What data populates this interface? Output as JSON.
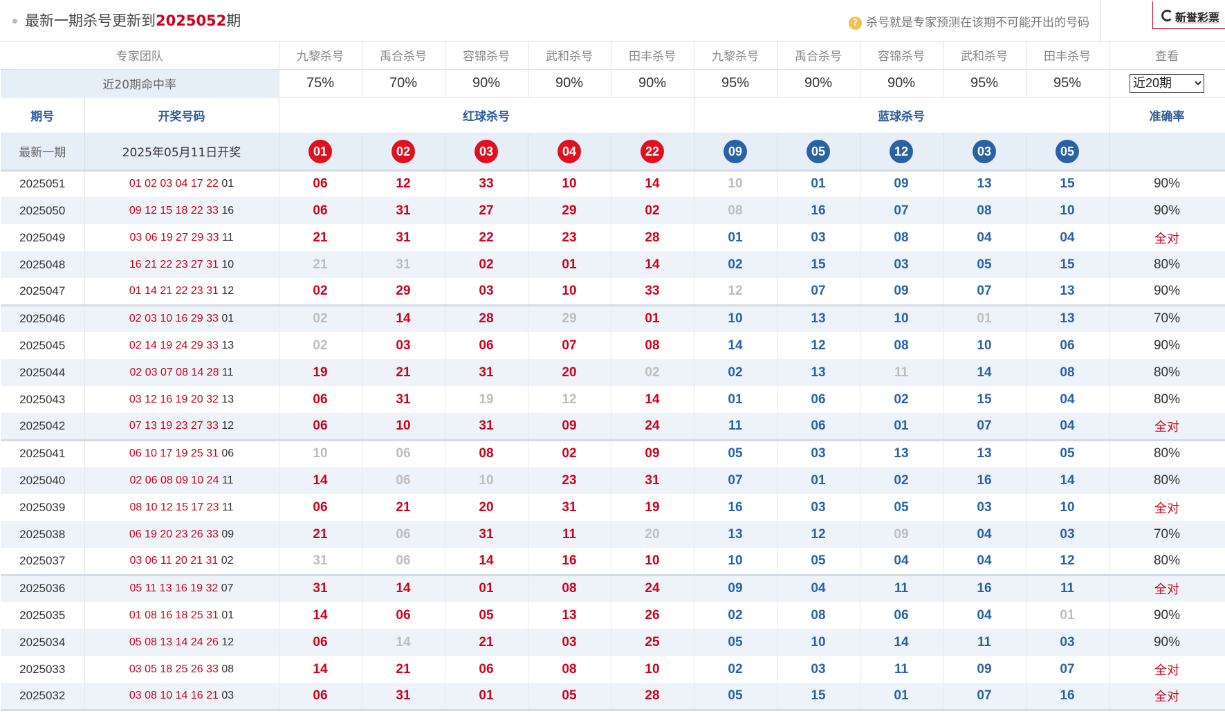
{
  "header": {
    "title_prefix": "最新一期杀号更新到",
    "issue": "2025052",
    "title_suffix": "期",
    "note_icon": "question-icon",
    "note": "杀号就是专家预测在该期不可能开出的号码",
    "logo_text": "新誉彩票"
  },
  "columns": {
    "team_label": "专家团队",
    "experts": [
      "九黎杀号",
      "禹合杀号",
      "容锦杀号",
      "武和杀号",
      "田丰杀号",
      "九黎杀号",
      "禹合杀号",
      "容锦杀号",
      "武和杀号",
      "田丰杀号"
    ],
    "view_label": "查看"
  },
  "hit_rates": {
    "label": "近20期命中率",
    "values": [
      "75%",
      "70%",
      "90%",
      "90%",
      "90%",
      "95%",
      "90%",
      "90%",
      "95%",
      "95%"
    ],
    "period_select": "近20期",
    "period_options": [
      "近20期"
    ]
  },
  "sections": {
    "issue_label": "期号",
    "draw_label": "开奖号码",
    "red_label": "红球杀号",
    "blue_label": "蓝球杀号",
    "accuracy_label": "准确率"
  },
  "latest": {
    "label": "最新一期",
    "draw_date": "2025年05月11日开奖",
    "red_kills": [
      "01",
      "02",
      "03",
      "04",
      "22"
    ],
    "blue_kills": [
      "09",
      "05",
      "12",
      "03",
      "05"
    ],
    "colors": {
      "red": "#e0101f",
      "blue": "#2a62a6"
    }
  },
  "history": [
    {
      "issue": "2025051",
      "red": "01 02 03 04 17 22",
      "blue": "01",
      "kills": [
        "06",
        "12",
        "33",
        "10",
        "14",
        "10",
        "01",
        "09",
        "13",
        "15"
      ],
      "miss": [
        5
      ],
      "acc": "90%"
    },
    {
      "issue": "2025050",
      "red": "09 12 15 18 22 33",
      "blue": "16",
      "kills": [
        "06",
        "31",
        "27",
        "29",
        "02",
        "08",
        "16",
        "07",
        "08",
        "10"
      ],
      "miss": [
        5
      ],
      "acc": "90%"
    },
    {
      "issue": "2025049",
      "red": "03 06 19 27 29 33",
      "blue": "11",
      "kills": [
        "21",
        "31",
        "22",
        "23",
        "28",
        "01",
        "03",
        "08",
        "04",
        "04"
      ],
      "miss": [],
      "acc": "全对"
    },
    {
      "issue": "2025048",
      "red": "16 21 22 23 27 31",
      "blue": "10",
      "kills": [
        "21",
        "31",
        "02",
        "01",
        "14",
        "02",
        "15",
        "03",
        "05",
        "15"
      ],
      "miss": [
        0,
        1
      ],
      "acc": "80%"
    },
    {
      "issue": "2025047",
      "red": "01 14 21 22 23 31",
      "blue": "12",
      "kills": [
        "02",
        "29",
        "03",
        "10",
        "33",
        "12",
        "07",
        "09",
        "07",
        "13"
      ],
      "miss": [
        5
      ],
      "acc": "90%"
    },
    {
      "issue": "2025046",
      "red": "02 03 10 16 29 33",
      "blue": "01",
      "kills": [
        "02",
        "14",
        "28",
        "29",
        "01",
        "10",
        "13",
        "10",
        "01",
        "13"
      ],
      "miss": [
        0,
        3,
        8
      ],
      "acc": "70%"
    },
    {
      "issue": "2025045",
      "red": "02 14 19 24 29 33",
      "blue": "13",
      "kills": [
        "02",
        "03",
        "06",
        "07",
        "08",
        "14",
        "12",
        "08",
        "10",
        "06"
      ],
      "miss": [
        0
      ],
      "acc": "90%"
    },
    {
      "issue": "2025044",
      "red": "02 03 07 08 14 28",
      "blue": "11",
      "kills": [
        "19",
        "21",
        "31",
        "20",
        "02",
        "02",
        "13",
        "11",
        "14",
        "08"
      ],
      "miss": [
        4,
        7
      ],
      "acc": "80%"
    },
    {
      "issue": "2025043",
      "red": "03 12 16 19 20 32",
      "blue": "13",
      "kills": [
        "06",
        "31",
        "19",
        "12",
        "14",
        "01",
        "06",
        "02",
        "15",
        "04"
      ],
      "miss": [
        2,
        3
      ],
      "acc": "80%"
    },
    {
      "issue": "2025042",
      "red": "07 13 19 23 27 33",
      "blue": "12",
      "kills": [
        "06",
        "10",
        "31",
        "09",
        "24",
        "11",
        "06",
        "01",
        "07",
        "04"
      ],
      "miss": [],
      "acc": "全对"
    },
    {
      "issue": "2025041",
      "red": "06 10 17 19 25 31",
      "blue": "06",
      "kills": [
        "10",
        "06",
        "08",
        "02",
        "09",
        "05",
        "03",
        "13",
        "13",
        "05"
      ],
      "miss": [
        0,
        1
      ],
      "acc": "80%"
    },
    {
      "issue": "2025040",
      "red": "02 06 08 09 10 24",
      "blue": "11",
      "kills": [
        "14",
        "06",
        "10",
        "23",
        "31",
        "07",
        "01",
        "02",
        "16",
        "14"
      ],
      "miss": [
        1,
        2
      ],
      "acc": "80%"
    },
    {
      "issue": "2025039",
      "red": "08 10 12 15 17 23",
      "blue": "11",
      "kills": [
        "06",
        "21",
        "20",
        "31",
        "19",
        "16",
        "03",
        "05",
        "03",
        "10"
      ],
      "miss": [],
      "acc": "全对"
    },
    {
      "issue": "2025038",
      "red": "06 19 20 23 26 33",
      "blue": "09",
      "kills": [
        "21",
        "06",
        "31",
        "11",
        "20",
        "13",
        "12",
        "09",
        "04",
        "03"
      ],
      "miss": [
        1,
        4,
        7
      ],
      "acc": "70%"
    },
    {
      "issue": "2025037",
      "red": "03 06 11 20 21 31",
      "blue": "02",
      "kills": [
        "31",
        "06",
        "14",
        "16",
        "10",
        "10",
        "05",
        "04",
        "04",
        "12"
      ],
      "miss": [
        0,
        1
      ],
      "acc": "80%"
    },
    {
      "issue": "2025036",
      "red": "05 11 13 16 19 32",
      "blue": "07",
      "kills": [
        "31",
        "14",
        "01",
        "08",
        "24",
        "09",
        "04",
        "11",
        "16",
        "11"
      ],
      "miss": [],
      "acc": "全对"
    },
    {
      "issue": "2025035",
      "red": "01 08 16 18 25 31",
      "blue": "01",
      "kills": [
        "14",
        "06",
        "05",
        "13",
        "26",
        "02",
        "08",
        "06",
        "04",
        "01"
      ],
      "miss": [
        9
      ],
      "acc": "90%"
    },
    {
      "issue": "2025034",
      "red": "05 08 13 14 24 26",
      "blue": "12",
      "kills": [
        "06",
        "14",
        "21",
        "03",
        "25",
        "05",
        "10",
        "14",
        "11",
        "03"
      ],
      "miss": [
        1
      ],
      "acc": "90%"
    },
    {
      "issue": "2025033",
      "red": "03 05 18 25 26 33",
      "blue": "08",
      "kills": [
        "14",
        "21",
        "06",
        "08",
        "10",
        "02",
        "03",
        "11",
        "09",
        "07"
      ],
      "miss": [],
      "acc": "全对"
    },
    {
      "issue": "2025032",
      "red": "03 08 10 14 16 21",
      "blue": "03",
      "kills": [
        "06",
        "31",
        "01",
        "05",
        "28",
        "05",
        "15",
        "01",
        "07",
        "16"
      ],
      "miss": [],
      "acc": "全对"
    }
  ]
}
